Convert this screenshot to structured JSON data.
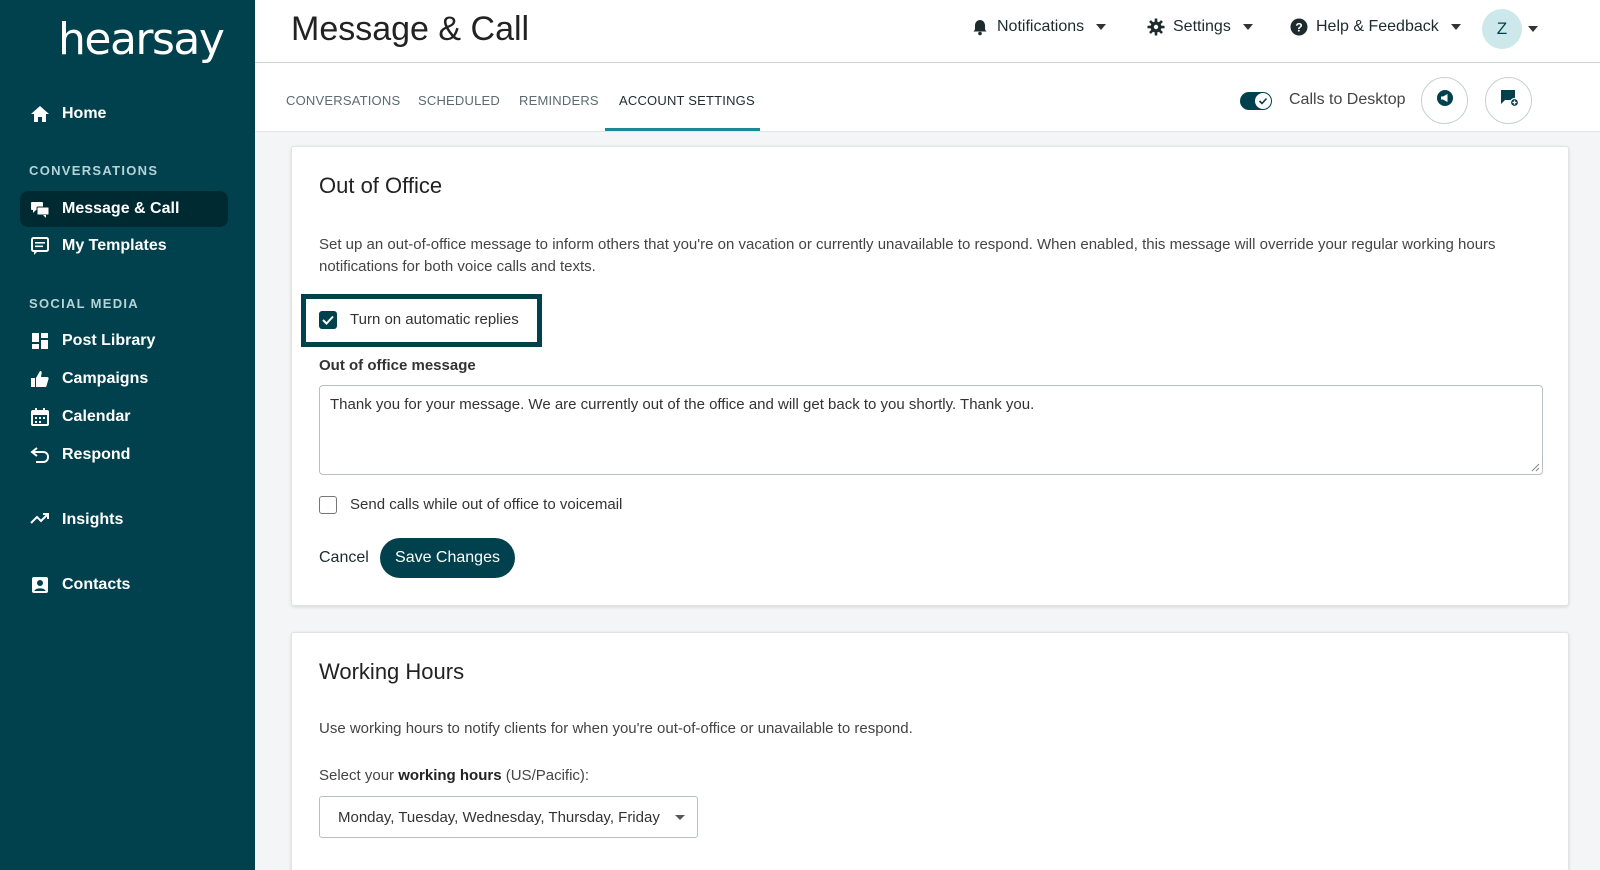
{
  "sidebar": {
    "logo": "hearsay",
    "home_label": "Home",
    "section_conversations": "CONVERSATIONS",
    "message_call_label": "Message & Call",
    "my_templates_label": "My Templates",
    "section_social": "SOCIAL MEDIA",
    "post_library_label": "Post Library",
    "campaigns_label": "Campaigns",
    "calendar_label": "Calendar",
    "respond_label": "Respond",
    "insights_label": "Insights",
    "contacts_label": "Contacts"
  },
  "header": {
    "title": "Message & Call",
    "notifications_label": "Notifications",
    "settings_label": "Settings",
    "help_label": "Help & Feedback",
    "avatar_initial": "Z"
  },
  "tabs": {
    "conversations": "CONVERSATIONS",
    "scheduled": "SCHEDULED",
    "reminders": "REMINDERS",
    "account_settings": "ACCOUNT SETTINGS",
    "active": "ACCOUNT SETTINGS",
    "calls_to_desktop_label": "Calls to Desktop",
    "calls_to_desktop_on": true
  },
  "out_of_office": {
    "title": "Out of Office",
    "description": "Set up an out-of-office message to inform others that you're on vacation or currently unavailable to respond. When enabled, this message will override your regular working hours notifications for both voice calls and texts.",
    "auto_replies_label": "Turn on automatic replies",
    "auto_replies_checked": true,
    "message_label": "Out of office message",
    "message_value": "Thank you for your message. We are currently out of the office and will get back to you shortly. Thank you.",
    "voicemail_label": "Send calls while out of office to voicemail",
    "voicemail_checked": false,
    "cancel_label": "Cancel",
    "save_label": "Save Changes"
  },
  "working_hours": {
    "title": "Working Hours",
    "description": "Use working hours to notify clients for when you're out-of-office or unavailable to respond.",
    "select_prefix": "Select your",
    "select_bold": "working hours",
    "select_suffix": "(US/Pacific):",
    "days_value": "Monday, Tuesday, Wednesday, Thursday, Friday"
  },
  "colors": {
    "brand_dark": "#01414d",
    "tab_accent": "#1b8a96",
    "avatar_bg": "#cde8ea"
  }
}
